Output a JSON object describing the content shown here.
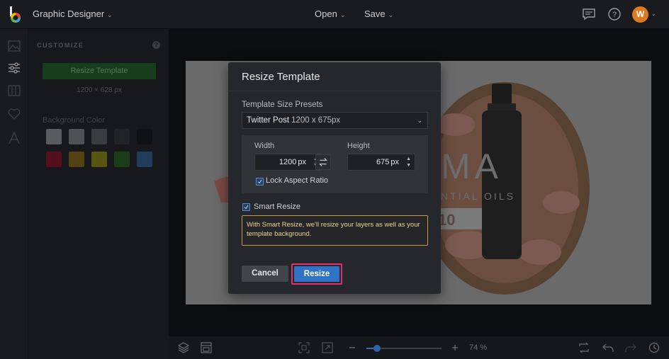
{
  "header": {
    "app_title": "Graphic Designer",
    "menu_open": "Open",
    "menu_save": "Save",
    "avatar_initial": "W"
  },
  "panel": {
    "title": "CUSTOMIZE",
    "help": "?",
    "resize_button": "Resize Template",
    "size_label": "1200 × 628 px",
    "background_color_label": "Background Color",
    "swatches": [
      "#e9e9e9",
      "#c9c9c9",
      "#8a8a8a",
      "#3a3a3a",
      "#050505",
      "#d3001f",
      "#d6a000",
      "#e2d800",
      "#2c8c14",
      "#3b8de2"
    ]
  },
  "modal": {
    "title": "Resize Template",
    "preset_label": "Template Size Presets",
    "preset_name": "Twitter Post",
    "preset_size": "1200 x 675px",
    "width_label": "Width",
    "width_value": "1200",
    "height_label": "Height",
    "height_value": "675",
    "unit": "px",
    "lock_label": "Lock Aspect Ratio",
    "lock_checked": true,
    "smart_label": "Smart Resize",
    "smart_checked": true,
    "smart_note": "With Smart Resize, we'll resize your layers as well as your template background.",
    "cancel_label": "Cancel",
    "resize_label": "Resize"
  },
  "canvas": {
    "headline_fragment": "MA",
    "subline_fragment": "NTIAL OILS",
    "number_fragment": "10"
  },
  "bottom": {
    "zoom_value": "74",
    "zoom_suffix": "%"
  },
  "colors": {
    "accent": "#2f73c7",
    "highlight": "#e0306d",
    "note_border": "#b99e3d"
  }
}
